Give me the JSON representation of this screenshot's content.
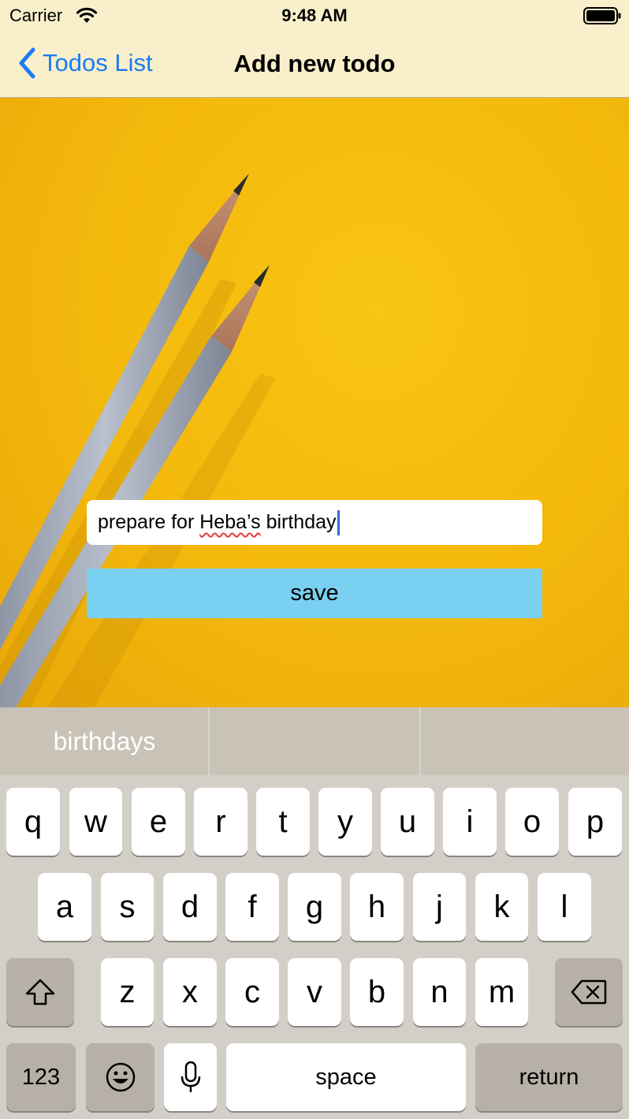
{
  "status_bar": {
    "carrier": "Carrier",
    "time": "9:48 AM"
  },
  "nav": {
    "back_label": "Todos List",
    "title": "Add new todo"
  },
  "form": {
    "input_value_prefix": "prepare for ",
    "input_value_misspelled": "Heba’s",
    "input_value_suffix": " birthday",
    "save_label": "save"
  },
  "keyboard": {
    "predictions": [
      "birthdays",
      "",
      ""
    ],
    "row1": [
      "q",
      "w",
      "e",
      "r",
      "t",
      "y",
      "u",
      "i",
      "o",
      "p"
    ],
    "row2": [
      "a",
      "s",
      "d",
      "f",
      "g",
      "h",
      "j",
      "k",
      "l"
    ],
    "row3": [
      "z",
      "x",
      "c",
      "v",
      "b",
      "n",
      "m"
    ],
    "numbers_label": "123",
    "space_label": "space",
    "return_label": "return",
    "icons": {
      "shift": "shift-icon",
      "delete": "backspace-icon",
      "emoji": "emoji-icon",
      "mic": "microphone-icon"
    }
  },
  "colors": {
    "nav_bg": "#f9efca",
    "back_tint": "#1a7cf5",
    "hero_yellow": "#f3b80c",
    "save_bg": "#79d0f0"
  }
}
